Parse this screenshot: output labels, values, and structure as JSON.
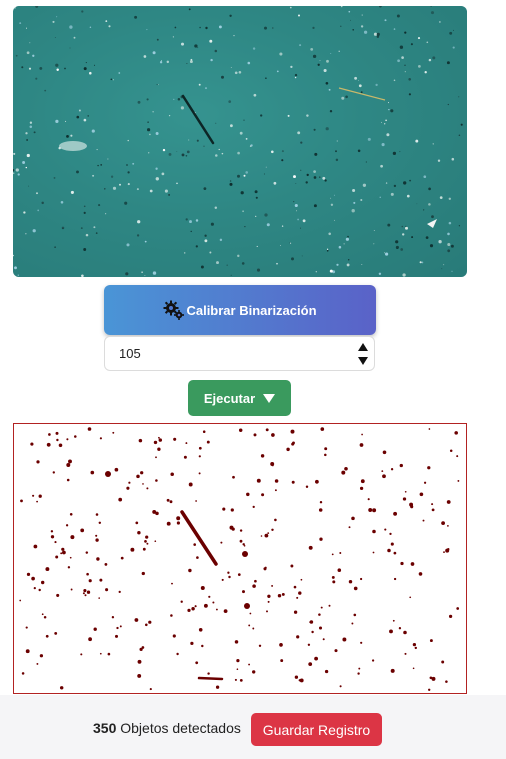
{
  "calibrate": {
    "label": "Calibrar Binarización",
    "icon": "gears-icon",
    "gradient_start": "#4a95d6",
    "gradient_end": "#5a62c8"
  },
  "threshold": {
    "value": "105"
  },
  "execute": {
    "label": "Ejecutar",
    "icon": "caret-down-icon",
    "color": "#3a9a5e"
  },
  "result": {
    "count": "350",
    "count_label": "Objetos detectados",
    "save_label": "Guardar Registro",
    "save_color": "#dc3545"
  },
  "colors": {
    "water": "#2f8784",
    "particle": "#6b0000",
    "binary_border": "#b22222"
  }
}
